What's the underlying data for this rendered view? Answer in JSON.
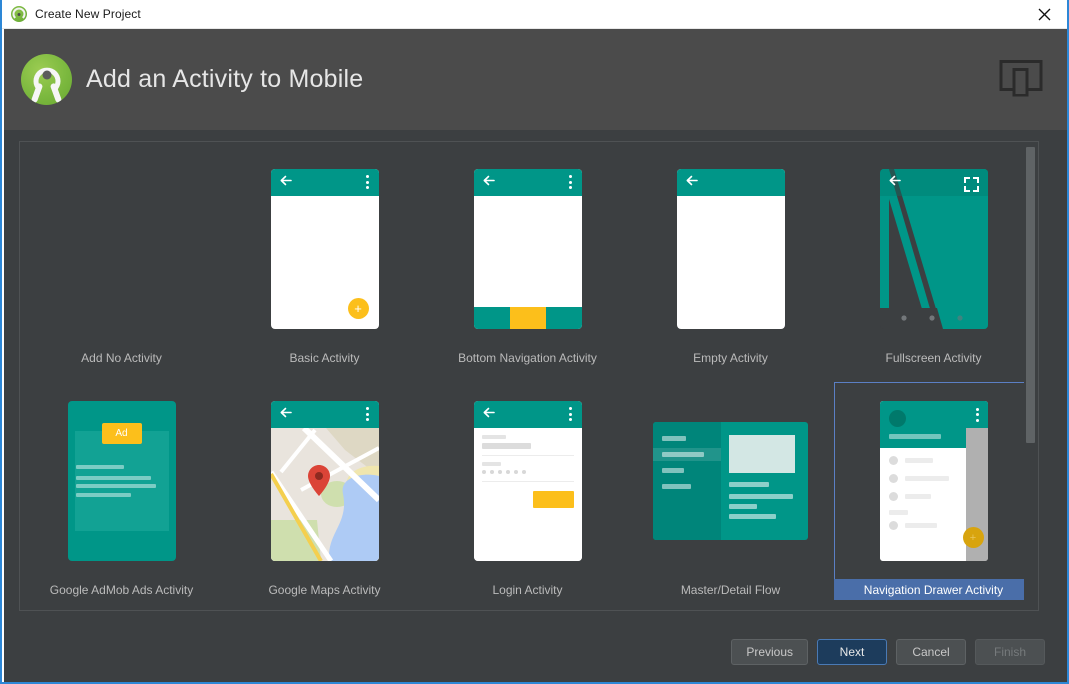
{
  "window": {
    "title": "Create New Project",
    "app_icon": "android-studio-icon",
    "close_label": "×"
  },
  "header": {
    "title": "Add an Activity to Mobile",
    "logo": "android-studio-logo",
    "form_factor_icon": "mobile-device-icon"
  },
  "gallery": {
    "items": [
      {
        "label": "Add No Activity",
        "thumb": "none",
        "selected": false
      },
      {
        "label": "Basic Activity",
        "thumb": "basic",
        "selected": false
      },
      {
        "label": "Bottom Navigation Activity",
        "thumb": "bottom-nav",
        "selected": false
      },
      {
        "label": "Empty Activity",
        "thumb": "empty",
        "selected": false
      },
      {
        "label": "Fullscreen Activity",
        "thumb": "fullscreen",
        "selected": false
      },
      {
        "label": "Google AdMob Ads Activity",
        "thumb": "admob",
        "selected": false
      },
      {
        "label": "Google Maps Activity",
        "thumb": "maps",
        "selected": false
      },
      {
        "label": "Login Activity",
        "thumb": "login",
        "selected": false
      },
      {
        "label": "Master/Detail Flow",
        "thumb": "master-detail",
        "selected": false
      },
      {
        "label": "Navigation Drawer Activity",
        "thumb": "nav-drawer",
        "selected": true
      }
    ],
    "admob_badge": "Ad",
    "fab_glyph": "+"
  },
  "footer": {
    "previous": "Previous",
    "next": "Next",
    "cancel": "Cancel",
    "finish": "Finish"
  },
  "colors": {
    "accent_teal": "#009688",
    "accent_yellow": "#fcbf1b",
    "selection_blue": "#4a6ea9",
    "panel_bg": "#3c3f41",
    "header_bg": "#4b4b4b",
    "window_border": "#2d87d6"
  }
}
